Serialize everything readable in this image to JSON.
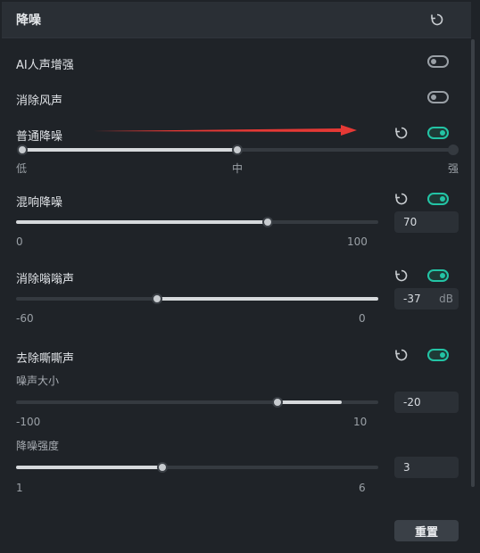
{
  "header": {
    "title": "降噪"
  },
  "items": {
    "ai_voice": {
      "label": "AI人声增强",
      "enabled": false
    },
    "wind": {
      "label": "消除风声",
      "enabled": false
    },
    "normal": {
      "label": "普通降噪",
      "enabled": true,
      "min_label": "低",
      "mid_label": "中",
      "max_label": "强",
      "level": "中"
    },
    "reverb": {
      "label": "混响降噪",
      "enabled": true,
      "min": "0",
      "max": "100",
      "value": "70"
    },
    "hum": {
      "label": "消除嗡嗡声",
      "enabled": true,
      "min": "-60",
      "max": "0",
      "value": "-37",
      "unit": "dB"
    },
    "hiss": {
      "label": "去除嘶嘶声",
      "enabled": true,
      "noise_size_label": "噪声大小",
      "noise_min": "-100",
      "noise_max": "10",
      "noise_value": "-20",
      "strength_label": "降噪强度",
      "strength_min": "1",
      "strength_max": "6",
      "strength_value": "3"
    }
  },
  "footer": {
    "reset_label": "重置"
  },
  "colors": {
    "accent": "#23c4a5",
    "arrow": "#e53935"
  }
}
